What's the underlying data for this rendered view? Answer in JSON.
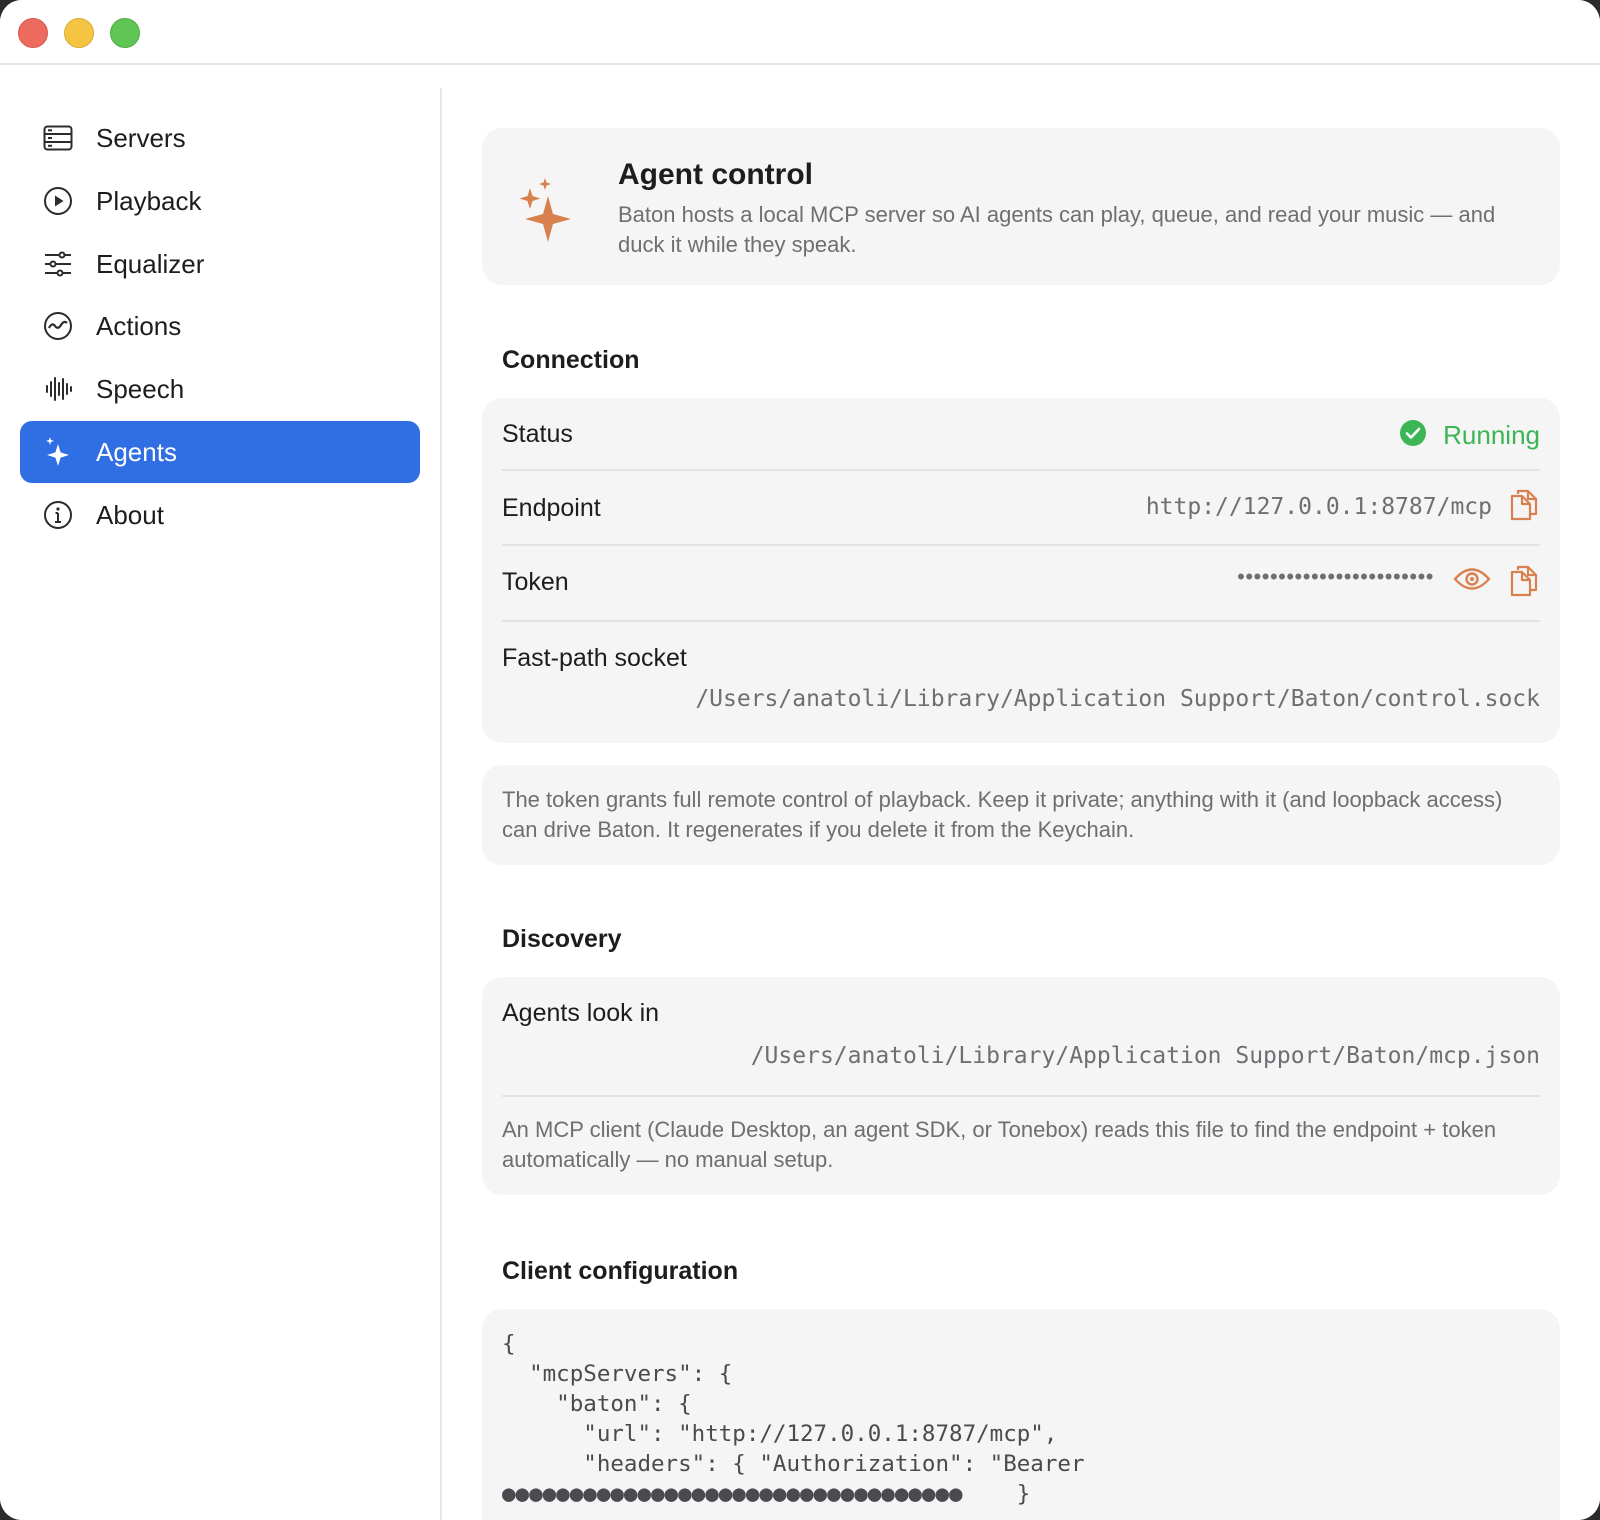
{
  "window": {
    "controls": {
      "close": "close",
      "minimize": "minimize",
      "zoom": "zoom"
    }
  },
  "sidebar": {
    "items": [
      {
        "label": "Servers",
        "icon": "server-icon",
        "active": false
      },
      {
        "label": "Playback",
        "icon": "play-circle-icon",
        "active": false
      },
      {
        "label": "Equalizer",
        "icon": "sliders-icon",
        "active": false
      },
      {
        "label": "Actions",
        "icon": "activity-icon",
        "active": false
      },
      {
        "label": "Speech",
        "icon": "waveform-icon",
        "active": false
      },
      {
        "label": "Agents",
        "icon": "sparkles-icon",
        "active": true
      },
      {
        "label": "About",
        "icon": "info-icon",
        "active": false
      }
    ]
  },
  "hero": {
    "title": "Agent control",
    "description": "Baton hosts a local MCP server so AI agents can play, queue, and read your music — and duck it while they speak.",
    "icon": "sparkles-icon"
  },
  "connection": {
    "title": "Connection",
    "status_label": "Status",
    "status_value": "Running",
    "endpoint_label": "Endpoint",
    "endpoint_value": "http://127.0.0.1:8787/mcp",
    "token_label": "Token",
    "token_value": "••••••••••••••••••••••••",
    "socket_label": "Fast-path socket",
    "socket_value": "/Users/anatoli/Library/Application Support/Baton/control.sock",
    "note": "The token grants full remote control of playback. Keep it private; anything with it (and loopback access) can drive Baton. It regenerates if you delete it from the Keychain."
  },
  "discovery": {
    "title": "Discovery",
    "label": "Agents look in",
    "path": "/Users/anatoli/Library/Application Support/Baton/mcp.json",
    "note": "An MCP client (Claude Desktop, an agent SDK, or Tonebox) reads this file to find the endpoint + token automatically — no manual setup."
  },
  "client_config": {
    "title": "Client configuration",
    "code": "{\n  \"mcpServers\": {\n    \"baton\": {\n      \"url\": \"http://127.0.0.1:8787/mcp\",\n      \"headers\": { \"Authorization\": \"Bearer\n●●●●●●●●●●●●●●●●●●●●●●●●●●●●●●●●●●    }"
  },
  "colors": {
    "accent": "#2f6ee3",
    "icon_orange": "#d9814e",
    "status_green": "#3cb554",
    "card_bg": "#f5f5f5"
  }
}
